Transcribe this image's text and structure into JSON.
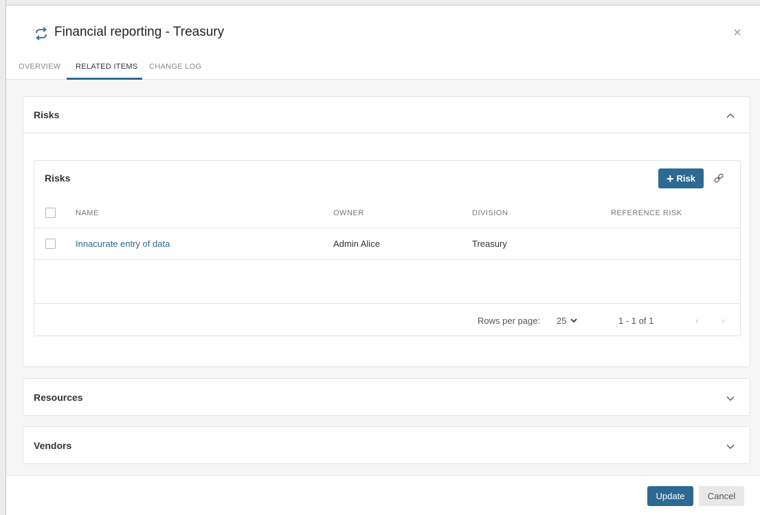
{
  "header": {
    "title": "Financial reporting - Treasury",
    "title_icon": "sync-arrows-icon",
    "close_icon": "close-icon"
  },
  "tabs": [
    {
      "label": "OVERVIEW",
      "active": false
    },
    {
      "label": "RELATED ITEMS",
      "active": true
    },
    {
      "label": "CHANGE LOG",
      "active": false
    }
  ],
  "sections": {
    "risks": {
      "title": "Risks",
      "expanded": true,
      "table": {
        "title": "Risks",
        "add_button_label": "Risk",
        "columns": [
          "NAME",
          "OWNER",
          "DIVISION",
          "REFERENCE RISK"
        ],
        "rows": [
          {
            "name": "Innacurate entry of data",
            "owner": "Admin Alice",
            "division": "Treasury",
            "reference_risk": ""
          }
        ],
        "rows_per_page_label": "Rows per page:",
        "rows_per_page_value": "25",
        "range_text": "1 - 1 of 1"
      }
    },
    "resources": {
      "title": "Resources",
      "expanded": false
    },
    "vendors": {
      "title": "Vendors",
      "expanded": false
    }
  },
  "footer": {
    "update_label": "Update",
    "cancel_label": "Cancel"
  },
  "colors": {
    "accent": "#2d6a93",
    "background": "#f6f6f6",
    "border": "#e3e3e3"
  }
}
